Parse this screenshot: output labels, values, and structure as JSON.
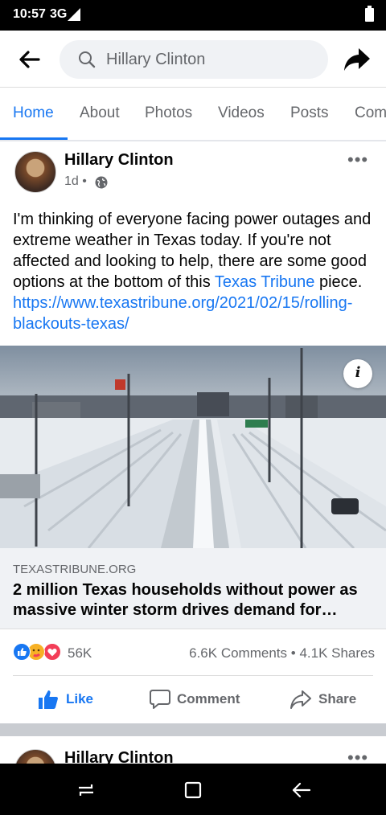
{
  "status": {
    "time": "10:57",
    "network": "3G"
  },
  "search": {
    "query": "Hillary Clinton"
  },
  "tabs": [
    "Home",
    "About",
    "Photos",
    "Videos",
    "Posts",
    "Com"
  ],
  "post": {
    "author": "Hillary Clinton",
    "time": "1d",
    "meta_sep": "•",
    "text_part1": "I'm thinking of everyone facing power outages and extreme weather in Texas today. If you're not affected and looking to help, there are some good options at the bottom of this ",
    "text_link1": "Texas Tribune",
    "text_part2": " piece. ",
    "text_link2": "https://www.texastribune.org/2021/02/15/rolling-blackouts-texas/",
    "info_label": "i",
    "link_domain": "TEXASTRIBUNE.ORG",
    "link_title": "2 million Texas households without power as massive winter storm drives demand for…",
    "reaction_count": "56K",
    "comments": "6.6K Comments",
    "stats_sep": "•",
    "shares": "4.1K Shares",
    "actions": {
      "like": "Like",
      "comment": "Comment",
      "share": "Share"
    }
  },
  "post2": {
    "author": "Hillary Clinton"
  },
  "icons": {
    "back": "arrow-left-icon",
    "search": "search-icon",
    "share_top": "share-arrow-icon",
    "more": "more-dots-icon",
    "globe": "globe-icon",
    "info": "info-icon",
    "reactions": [
      "like-reaction-icon",
      "care-reaction-icon",
      "love-reaction-icon"
    ],
    "like": "thumbs-up-icon",
    "comment": "comment-bubble-icon",
    "share": "share-icon",
    "nav": [
      "recents-icon",
      "home-square-icon",
      "back-arrow-icon"
    ]
  },
  "colors": {
    "accent": "#1877f2",
    "love": "#f33e58",
    "care": "#f7b125",
    "gray_text": "#65676b"
  }
}
